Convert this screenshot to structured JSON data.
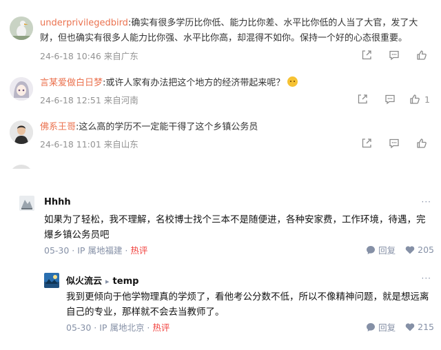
{
  "weibo": {
    "comments": [
      {
        "user": "underprivilegedbird",
        "text": ":确实有很多学历比你低、能力比你差、水平比你低的人当了大官，发了大财，但也确实有很多人能力比你强、水平比你高，却混得不如你。保持一个好的心态很重要。",
        "meta": "24-6-18 10:46 来自广东",
        "likes": ""
      },
      {
        "user": "言某爱做白日梦",
        "text": ":或许人家有办法把这个地方的经济带起来呢？",
        "meta": "24-6-18 12:51 来自河南",
        "likes": "1"
      },
      {
        "user": "佛系王哥",
        "text": ":这么高的学历不一定能干得了这个乡镇公务员",
        "meta": "24-6-18 11:01 来自山东",
        "likes": ""
      }
    ]
  },
  "zhihu": {
    "comment": {
      "name": "Hhhh",
      "text": "如果为了轻松，我不理解，名校博士找个三本不是随便进，各种安家费，工作环境，待遇，完爆乡镇公务员吧",
      "meta_date": "05-30",
      "meta_sep": " · ",
      "meta_ip": "IP 属地福建",
      "meta_hot": "热评",
      "reply_label": "回复",
      "likes": "205",
      "more": "···"
    },
    "reply": {
      "name": "似火流云",
      "reply_to": "temp",
      "text": "我到更倾向于他学物理真的学烦了，看他考公分数不低，所以不像精神问题，就是想远离自己的专业，那样就不会去当教师了。",
      "meta_date": "05-30",
      "meta_sep": " · ",
      "meta_ip": "IP 属地北京",
      "meta_hot": "热评",
      "reply_label": "回复",
      "likes": "215",
      "more": "···"
    }
  },
  "colors": {
    "weibo_username": "#eb7350",
    "weibo_meta": "#939393",
    "zhihu_meta": "#8590a6",
    "zhihu_hot": "#f1403c"
  },
  "icons": [
    "share-icon",
    "comment-icon",
    "like-icon",
    "reply-icon",
    "heart-icon",
    "more-icon",
    "emoji-icon",
    "reply-arrow-icon"
  ]
}
